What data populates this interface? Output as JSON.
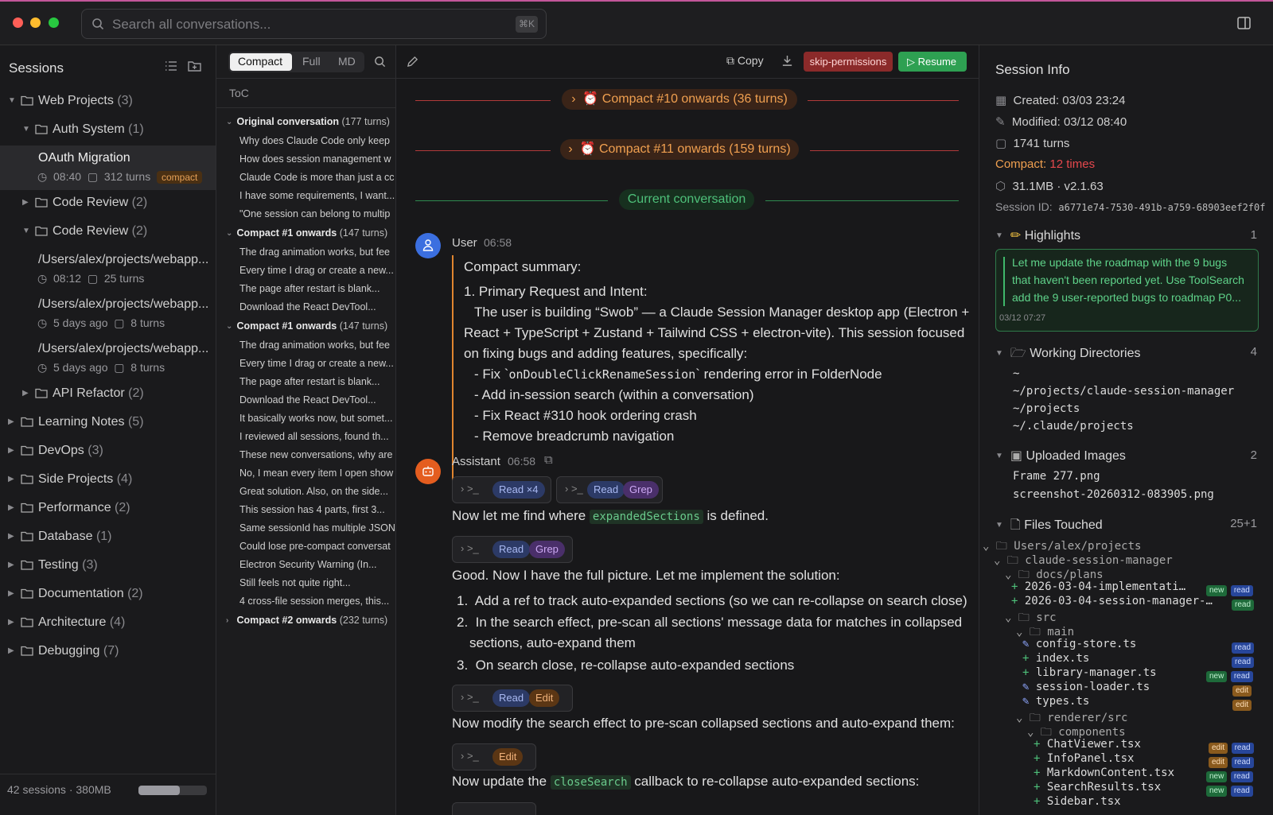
{
  "search": {
    "placeholder": "Search all conversations...",
    "shortcut": "⌘K"
  },
  "sidebar": {
    "title": "Sessions",
    "tree": [
      {
        "label": "Web Projects",
        "count": "(3)"
      },
      {
        "label": "Auth System",
        "count": "(1)"
      },
      {
        "label": "Code Review",
        "count": "(2)"
      },
      {
        "label": "Code Review",
        "count": "(2)"
      },
      {
        "label": "API Refactor",
        "count": "(2)"
      },
      {
        "label": "Learning Notes",
        "count": "(5)"
      },
      {
        "label": "DevOps",
        "count": "(3)"
      },
      {
        "label": "Side Projects",
        "count": "(4)"
      },
      {
        "label": "Performance",
        "count": "(2)"
      },
      {
        "label": "Database",
        "count": "(1)"
      },
      {
        "label": "Testing",
        "count": "(3)"
      },
      {
        "label": "Documentation",
        "count": "(2)"
      },
      {
        "label": "Architecture",
        "count": "(4)"
      },
      {
        "label": "Debugging",
        "count": "(7)"
      }
    ],
    "sessions": [
      {
        "title": "OAuth Migration",
        "time": "08:40",
        "turns": "312 turns",
        "badge": "compact"
      },
      {
        "title": "/Users/alex/projects/webapp...",
        "time": "08:12",
        "turns": "25 turns"
      },
      {
        "title": "/Users/alex/projects/webapp...",
        "time": "5 days ago",
        "turns": "8 turns"
      },
      {
        "title": "/Users/alex/projects/webapp...",
        "time": "5 days ago",
        "turns": "8 turns"
      }
    ],
    "footer": "42 sessions · 380MB",
    "storage_fraction": 0.6
  },
  "toolbar": {
    "modes": [
      "Compact",
      "Full",
      "MD"
    ],
    "copy": "Copy",
    "skip": "skip-permissions",
    "resume": "Resume"
  },
  "toc": {
    "title": "ToC",
    "groups": [
      {
        "title": "Original conversation",
        "turns": "(177 turns)",
        "items": [
          "Why does Claude Code only keep",
          "How does session management w",
          "Claude Code is more than just a cc",
          "I have some requirements, I want...",
          "\"One session can belong to multip"
        ]
      },
      {
        "title": "Compact #1 onwards",
        "turns": "(147 turns)",
        "items": [
          "The drag animation works, but fee",
          "Every time I drag or create a new...",
          "The page after restart is blank...",
          "Download the React DevTool..."
        ]
      },
      {
        "title": "Compact #1 onwards",
        "turns": "(147 turns)",
        "items": [
          "The drag animation works, but fee",
          "Every time I drag or create a new...",
          "The page after restart is blank...",
          "Download the React DevTool...",
          "It basically works now, but somet...",
          "I reviewed all sessions, found th...",
          "These new conversations, why are",
          "No, I mean every item I open show",
          "Great solution. Also, on the side...",
          "This session has 4 parts, first 3...",
          "Same sessionId has multiple JSON",
          "Could lose pre-compact conversat",
          "Electron Security Warning (In...",
          "Still feels not quite right...",
          "4 cross-file session merges, this..."
        ]
      },
      {
        "title": "Compact #2 onwards",
        "turns": "(232 turns)",
        "items": []
      }
    ]
  },
  "chat": {
    "dividers": [
      "Compact #10 onwards (36 turns)",
      "Compact #11 onwards (159 turns)",
      "Current conversation"
    ],
    "user": {
      "name": "User",
      "time": "06:58",
      "heading": "Compact summary:",
      "p1": "1. Primary Request and Intent:",
      "p2": "The user is building “Swob” — a Claude Session Manager desktop app (Electron +",
      "p3": "React + TypeScript + Zustand + Tailwind CSS + electron-vite). This session focused",
      "p4": "on fixing bugs and adding features, specifically:",
      "b1a": "- Fix `",
      "b1code": "onDoubleClickRenameSession",
      "b1b": "` rendering error in FolderNode",
      "b2": "- Add in-session search (within a conversation)",
      "b3": "- Fix React #310 hook ordering crash",
      "b4": "- Remove breadcrumb navigation"
    },
    "assistant": {
      "name": "Assistant",
      "time": "06:58",
      "tool1": [
        "Read",
        "×4"
      ],
      "tool2": [
        "Read",
        "Grep"
      ],
      "l1a": "Now let me find where ",
      "l1code": "expandedSections",
      "l1b": " is defined.",
      "tool3": [
        "Read",
        "Grep"
      ],
      "l2": "Good. Now I have the full picture. Let me implement the solution:",
      "o1": "Add a ref to track auto-expanded sections (so we can re-collapse on search close)",
      "o2a": "In the search effect, pre-scan all sections' message data for matches in collapsed",
      "o2b": "sections, auto-expand them",
      "o3": "On search close, re-collapse auto-expanded sections",
      "tool4": [
        "Read",
        "Edit"
      ],
      "l3": "Now modify the search effect to pre-scan collapsed sections and auto-expand them:",
      "tool5": [
        "Edit"
      ],
      "l4a": "Now update the ",
      "l4code": "closeSearch",
      "l4b": " callback to re-collapse auto-expanded sections:"
    }
  },
  "info": {
    "title": "Session Info",
    "created": "Created: 03/03 23:24",
    "modified": "Modified: 03/12 08:40",
    "turns": "1741 turns",
    "compact_label": "Compact:",
    "compact_value": "12 times",
    "size": "31.1MB · v2.1.63",
    "sid_label": "Session ID:",
    "sid": "a6771e74-7530-491b-a759-68903eef2f0f",
    "highlights": {
      "title": "Highlights",
      "count": "1",
      "text1": "Let me update the roadmap with the 9 bugs",
      "text2": "that haven't been reported yet. Use ToolSearch",
      "text3": "add the 9 user-reported bugs to roadmap P0...",
      "date": "03/12 07:27"
    },
    "dirs": {
      "title": "Working Directories",
      "count": "4",
      "items": [
        "~",
        "~/projects/claude-session-manager",
        "~/projects",
        "~/.claude/projects"
      ]
    },
    "images": {
      "title": "Uploaded Images",
      "count": "2",
      "items": [
        "Frame 277.png",
        "screenshot-20260312-083905.png"
      ]
    },
    "files": {
      "title": "Files Touched",
      "count": "25+1",
      "rows": [
        "Users/alex/projects",
        "claude-session-manager",
        "docs/plans",
        "2026-03-04-implementati…",
        "2026-03-04-session-manager-…",
        "src",
        "main",
        "config-store.ts",
        "index.ts",
        "library-manager.ts",
        "session-loader.ts",
        "types.ts",
        "renderer/src",
        "components",
        "ChatViewer.tsx",
        "InfoPanel.tsx",
        "MarkdownContent.tsx",
        "SearchResults.tsx",
        "Sidebar.tsx"
      ],
      "badges": {
        "new": "new",
        "read": "read",
        "edit": "edit"
      }
    }
  },
  "colors": {
    "accent_red": "#e5484d",
    "accent_orange": "#f0a050",
    "accent_green": "#3fb96a",
    "resume": "#2ea052",
    "skip": "#8b2a2a"
  }
}
